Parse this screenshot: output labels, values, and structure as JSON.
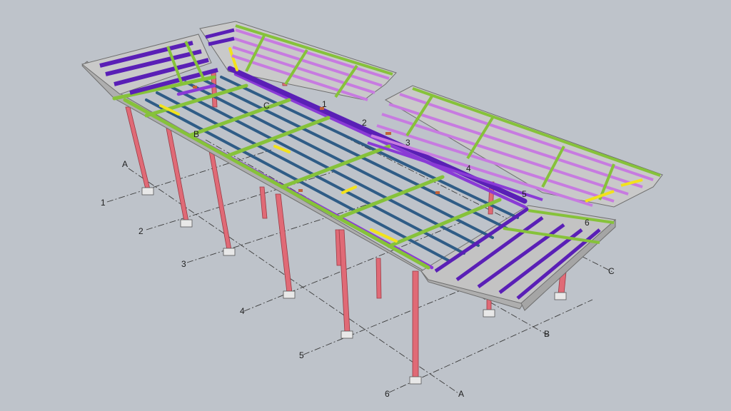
{
  "scene": {
    "grid_row_labels": [
      "1",
      "2",
      "3",
      "4",
      "5",
      "6"
    ],
    "grid_col_labels": [
      "A",
      "B",
      "C"
    ],
    "roof_grid_labels": [
      "C",
      "B",
      "1",
      "2",
      "3",
      "4",
      "5",
      "6"
    ]
  },
  "colors": {
    "background": "#bec3ca",
    "column": "#e06a76",
    "edge_slab": "#b7b7b7",
    "purple_beam": "#8a3ad6",
    "dark_purple_beam": "#5a1fb6",
    "light_purple_beam": "#c77be0",
    "blue_beam": "#2f5c86",
    "green_girder": "#86c23a",
    "yellow_member": "#f2e21c"
  }
}
